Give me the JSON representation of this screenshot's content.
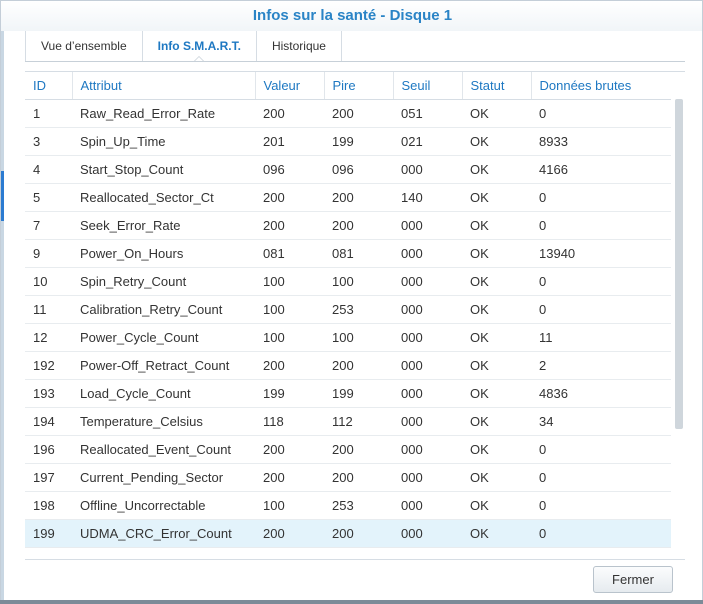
{
  "window": {
    "title": "Infos sur la santé - Disque 1"
  },
  "tabs": [
    {
      "label": "Vue d’ensemble",
      "active": false
    },
    {
      "label": "Info S.M.A.R.T.",
      "active": true
    },
    {
      "label": "Historique",
      "active": false
    }
  ],
  "table": {
    "columns": [
      "ID",
      "Attribut",
      "Valeur",
      "Pire",
      "Seuil",
      "Statut",
      "Données brutes"
    ],
    "rows": [
      [
        "1",
        "Raw_Read_Error_Rate",
        "200",
        "200",
        "051",
        "OK",
        "0"
      ],
      [
        "3",
        "Spin_Up_Time",
        "201",
        "199",
        "021",
        "OK",
        "8933"
      ],
      [
        "4",
        "Start_Stop_Count",
        "096",
        "096",
        "000",
        "OK",
        "4166"
      ],
      [
        "5",
        "Reallocated_Sector_Ct",
        "200",
        "200",
        "140",
        "OK",
        "0"
      ],
      [
        "7",
        "Seek_Error_Rate",
        "200",
        "200",
        "000",
        "OK",
        "0"
      ],
      [
        "9",
        "Power_On_Hours",
        "081",
        "081",
        "000",
        "OK",
        "13940"
      ],
      [
        "10",
        "Spin_Retry_Count",
        "100",
        "100",
        "000",
        "OK",
        "0"
      ],
      [
        "11",
        "Calibration_Retry_Count",
        "100",
        "253",
        "000",
        "OK",
        "0"
      ],
      [
        "12",
        "Power_Cycle_Count",
        "100",
        "100",
        "000",
        "OK",
        "11"
      ],
      [
        "192",
        "Power-Off_Retract_Count",
        "200",
        "200",
        "000",
        "OK",
        "2"
      ],
      [
        "193",
        "Load_Cycle_Count",
        "199",
        "199",
        "000",
        "OK",
        "4836"
      ],
      [
        "194",
        "Temperature_Celsius",
        "118",
        "112",
        "000",
        "OK",
        "34"
      ],
      [
        "196",
        "Reallocated_Event_Count",
        "200",
        "200",
        "000",
        "OK",
        "0"
      ],
      [
        "197",
        "Current_Pending_Sector",
        "200",
        "200",
        "000",
        "OK",
        "0"
      ],
      [
        "198",
        "Offline_Uncorrectable",
        "100",
        "253",
        "000",
        "OK",
        "0"
      ],
      [
        "199",
        "UDMA_CRC_Error_Count",
        "200",
        "200",
        "000",
        "OK",
        "0"
      ]
    ],
    "selected_row_index": 15
  },
  "footer": {
    "close_label": "Fermer"
  },
  "colors": {
    "title": "#2a84c6",
    "header_text": "#1e78c2",
    "selected_row": "#e3f3fb"
  }
}
